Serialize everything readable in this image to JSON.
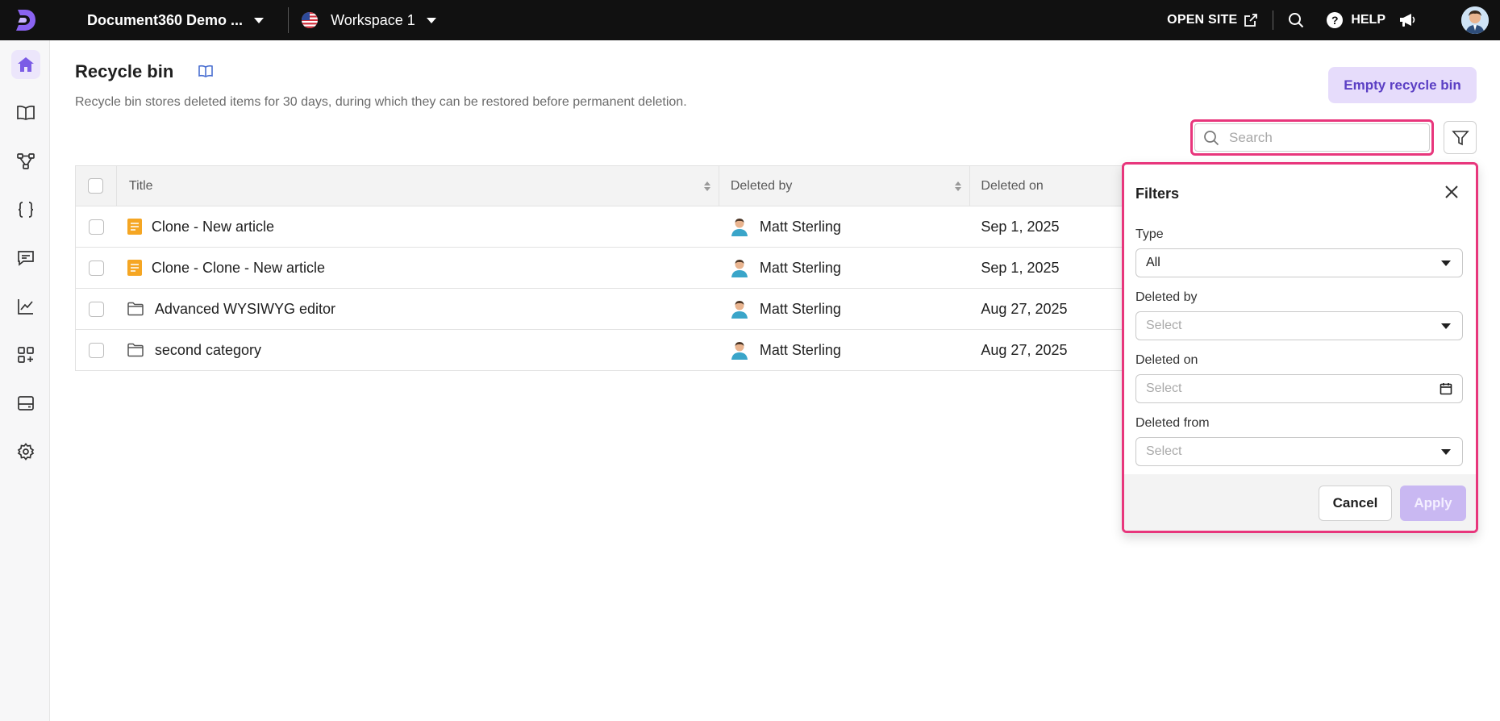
{
  "topbar": {
    "project_name": "Document360 Demo ...",
    "workspace_name": "Workspace 1",
    "open_site_label": "OPEN SITE",
    "help_label": "HELP",
    "icons": [
      "logo-icon",
      "us-flag-icon",
      "external-link-icon",
      "search-icon",
      "help-icon",
      "megaphone-icon",
      "avatar"
    ]
  },
  "sidebar": {
    "items": [
      {
        "name": "home",
        "icon": "home-icon",
        "active": true
      },
      {
        "name": "documentation",
        "icon": "book-icon"
      },
      {
        "name": "workflow",
        "icon": "workflow-icon"
      },
      {
        "name": "api",
        "icon": "braces-icon"
      },
      {
        "name": "feedback",
        "icon": "comment-icon"
      },
      {
        "name": "analytics",
        "icon": "chart-icon"
      },
      {
        "name": "integrations",
        "icon": "apps-icon"
      },
      {
        "name": "widgets",
        "icon": "widget-icon"
      },
      {
        "name": "settings",
        "icon": "gear-icon"
      }
    ]
  },
  "page": {
    "title": "Recycle bin",
    "description": "Recycle bin stores deleted items for 30 days, during which they can be restored before permanent deletion.",
    "empty_button": "Empty recycle bin",
    "search_placeholder": "Search"
  },
  "table": {
    "columns": {
      "title": "Title",
      "deleted_by": "Deleted by",
      "deleted_on": "Deleted on"
    },
    "rows": [
      {
        "type": "article",
        "title": "Clone - New article",
        "deleted_by": "Matt Sterling",
        "deleted_on": "Sep 1, 2025"
      },
      {
        "type": "article",
        "title": "Clone - Clone - New article",
        "deleted_by": "Matt Sterling",
        "deleted_on": "Sep 1, 2025"
      },
      {
        "type": "category",
        "title": "Advanced WYSIWYG editor",
        "deleted_by": "Matt Sterling",
        "deleted_on": "Aug 27, 2025"
      },
      {
        "type": "category",
        "title": "second category",
        "deleted_by": "Matt Sterling",
        "deleted_on": "Aug 27, 2025"
      }
    ]
  },
  "filters": {
    "title": "Filters",
    "type_label": "Type",
    "type_value": "All",
    "deleted_by_label": "Deleted by",
    "deleted_by_placeholder": "Select",
    "deleted_on_label": "Deleted on",
    "deleted_on_placeholder": "Select",
    "deleted_from_label": "Deleted from",
    "deleted_from_placeholder": "Select",
    "cancel_label": "Cancel",
    "apply_label": "Apply"
  },
  "colors": {
    "accent": "#7b5ce6",
    "highlight": "#e8367c",
    "article_icon": "#f5a623"
  }
}
